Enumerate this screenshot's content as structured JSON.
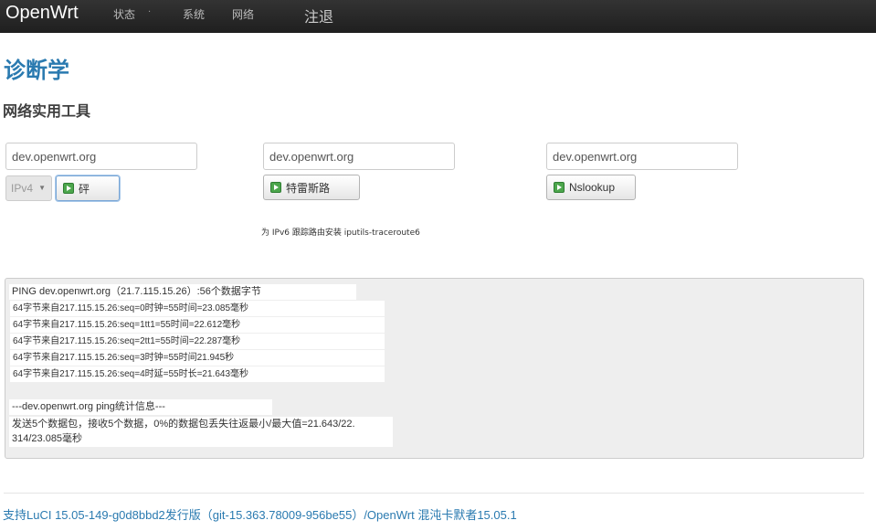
{
  "navbar": {
    "brand": "OpenWrt",
    "items": [
      {
        "label": "状态"
      },
      {
        "label": "系统"
      },
      {
        "label": "网络"
      }
    ],
    "separator": "·",
    "logout": "注退"
  },
  "page": {
    "title": "诊断学",
    "section_title": "网络实用工具"
  },
  "tools": {
    "ping": {
      "value": "dev.openwrt.org",
      "protocol": "IPv4",
      "button": "砰"
    },
    "traceroute": {
      "value": "dev.openwrt.org",
      "button": "特雷斯路"
    },
    "nslookup": {
      "value": "dev.openwrt.org",
      "button": "Nslookup"
    },
    "hint": "为 IPv6 跟踪路由安装 iputils-traceroute6"
  },
  "output": {
    "header": "PING dev.openwrt.org（21.7.115.15.26）:56个数据字节",
    "lines": [
      "64字节来自217.115.15.26:seq=0时钟=55时间=23.085毫秒",
      "64字节来自217.115.15.26:seq=1tt1=55时间=22.612毫秒",
      "64字节来自217.115.15.26:seq=2tt1=55时间=22.287毫秒",
      "64字节来自217.115.15.26:seq=3时钟=55时间21.945秒",
      "64字节来自217.115.15.26:seq=4时延=55时长=21.643毫秒"
    ],
    "stats_header": "---dev.openwrt.org ping统计信息---",
    "summary_line1": "发送5个数据包，接收5个数据，0%的数据包丢失往返最小/最大值=21.643/22.",
    "summary_line2": "314/23.085毫秒"
  },
  "footer": {
    "text": "支持LuCI 15.05-149-g0d8bbd2发行版（git-15.363.78009-956be55）/OpenWrt 混沌卡默者15.05.1"
  },
  "colors": {
    "navbar": "#222222",
    "link": "#2a7ab0",
    "output_bg": "#eeeeee"
  }
}
